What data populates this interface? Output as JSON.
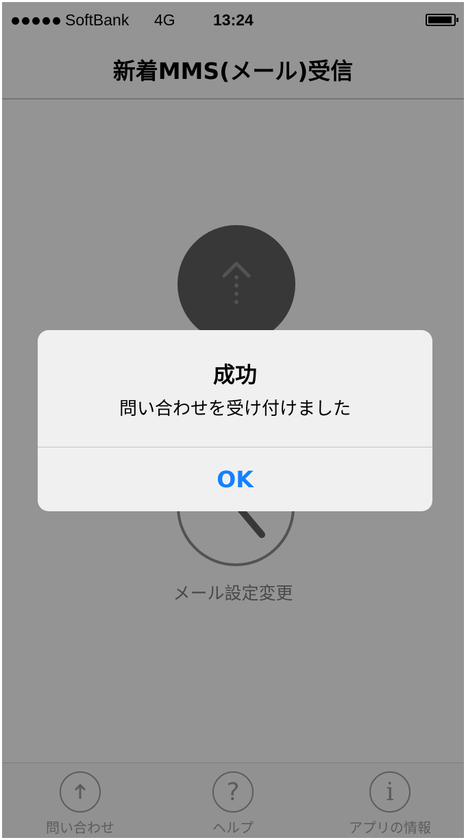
{
  "status_bar": {
    "carrier": "SoftBank",
    "network": "4G",
    "time": "13:24"
  },
  "nav": {
    "title": "新着MMS(メール)受信"
  },
  "content": {
    "upload_icon": "dotted-up-arrow-icon",
    "mail_settings_icon": "magnifier-icon",
    "mail_settings_label": "メール設定変更"
  },
  "tabs": [
    {
      "label": "問い合わせ",
      "icon": "up-arrow-icon",
      "glyph": "↑"
    },
    {
      "label": "ヘルプ",
      "icon": "question-icon",
      "glyph": "?"
    },
    {
      "label": "アプリの情報",
      "icon": "info-icon",
      "glyph": "i"
    }
  ],
  "alert": {
    "title": "成功",
    "message": "問い合わせを受け付けました",
    "ok_label": "OK"
  },
  "colors": {
    "accent": "#1680ff",
    "overlay": "#000000"
  }
}
